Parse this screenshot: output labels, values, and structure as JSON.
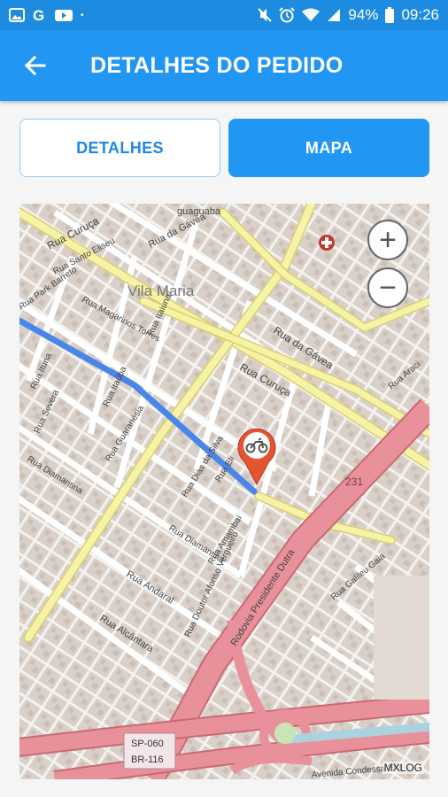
{
  "status_bar": {
    "battery": "94%",
    "time": "09:26",
    "icons": [
      "gallery-icon",
      "google-icon",
      "youtube-icon",
      "mute-icon",
      "alarm-icon",
      "wifi-icon",
      "signal-icon",
      "battery-icon"
    ]
  },
  "app_bar": {
    "title": "DETALHES DO PEDIDO",
    "back_icon": "arrow-back-icon"
  },
  "tabs": [
    {
      "label": "DETALHES",
      "selected": false
    },
    {
      "label": "MAPA",
      "selected": true
    }
  ],
  "map": {
    "zoom_in": "+",
    "zoom_out": "−",
    "attribution": "MXLOG",
    "labels": {
      "vila_maria": "Vila Maria",
      "rua_curuca_1": "Rua Curuça",
      "rua_curuca_2": "Rua Curuça",
      "rua_da_gavea_1": "Rua da Gávea",
      "rua_da_gavea_2": "Rua da Gávea",
      "rua_santo_eliseu": "Rua Santo Eliseu",
      "rua_magarinos_torres": "Rua Magarinos Torres",
      "rua_ituna": "Rua Ituna",
      "rua_severa": "Rua Severa",
      "rua_diamantina_1": "Rua Diamantina",
      "rua_diamantina_2": "Rua Diamantina",
      "rua_guaranesia": "Rua Guaranésia",
      "rua_dias_da_silva": "Rua Dias da Silva",
      "rua_andaral": "Rua Andaral",
      "rua_alcantara": "Rua Alcântara",
      "rua_amambai": "Rua Amambaí",
      "rua_doutor_afonso_vergueiro": "Rua Doutor Afonso Vergueiro",
      "rodovia": "Rodovia Presidente Dutra",
      "rua_galileu_gaia": "Rua Galileu Gaia",
      "rua_araci": "Rua Araci",
      "rua_guaguaba": "guaguaba",
      "shield_sp": "SP-060",
      "shield_br": "BR-116",
      "road_231": "231",
      "avenida": "Avenida Condessa Eliz",
      "rua_eli": "Rua Eli",
      "rua_park_barreto": "Rua Park Barreto",
      "rua_itaiuna": "Rua Itaiuna",
      "rua_itauba": "Rua Itaúba"
    },
    "marker_icon": "motorcycle-icon",
    "hospital_icon": "hospital-cross-icon"
  }
}
